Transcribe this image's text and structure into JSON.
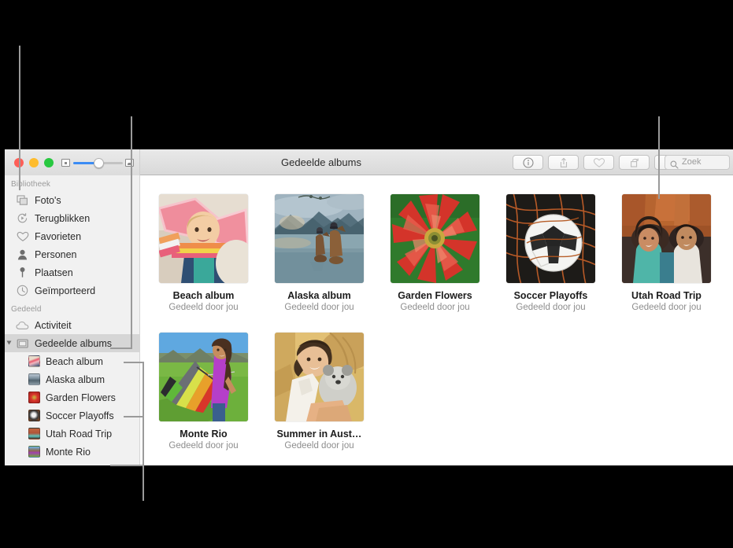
{
  "window": {
    "title": "Gedeelde albums",
    "traffic_lights": [
      "close",
      "minimize",
      "maximize"
    ],
    "zoom_slider": {
      "min_icon": "small-thumbnail-icon",
      "max_icon": "large-thumbnail-icon",
      "value_percent": 47
    }
  },
  "toolbar": {
    "buttons": [
      {
        "name": "info-button",
        "icon": "info-icon"
      },
      {
        "name": "share-button",
        "icon": "share-icon"
      },
      {
        "name": "favorite-button",
        "icon": "heart-icon"
      },
      {
        "name": "rotate-button",
        "icon": "rotate-icon"
      },
      {
        "name": "add-button",
        "icon": "plus-icon"
      }
    ],
    "search": {
      "placeholder": "Zoek",
      "value": "",
      "icon": "search-icon"
    }
  },
  "sidebar": {
    "sections": [
      {
        "header": "Bibliotheek",
        "items": [
          {
            "label": "Foto's",
            "icon": "photos-icon"
          },
          {
            "label": "Terugblikken",
            "icon": "memories-icon"
          },
          {
            "label": "Favorieten",
            "icon": "heart-icon"
          },
          {
            "label": "Personen",
            "icon": "person-icon"
          },
          {
            "label": "Plaatsen",
            "icon": "pin-icon"
          },
          {
            "label": "Geïmporteerd",
            "icon": "clock-icon"
          }
        ]
      },
      {
        "header": "Gedeeld",
        "items": [
          {
            "label": "Activiteit",
            "icon": "cloud-icon"
          },
          {
            "label": "Gedeelde albums",
            "icon": "shared-albums-icon",
            "selected": true,
            "expanded": true
          }
        ],
        "children": [
          {
            "label": "Beach album",
            "thumb": "beach"
          },
          {
            "label": "Alaska album",
            "thumb": "alaska"
          },
          {
            "label": "Garden Flowers",
            "thumb": "garden"
          },
          {
            "label": "Soccer Playoffs",
            "thumb": "soccer"
          },
          {
            "label": "Utah Road Trip",
            "thumb": "utah"
          },
          {
            "label": "Monte Rio",
            "thumb": "monte"
          }
        ]
      }
    ]
  },
  "main": {
    "albums": [
      {
        "title": "Beach album",
        "subtitle": "Gedeeld door jou",
        "thumb": "beach"
      },
      {
        "title": "Alaska album",
        "subtitle": "Gedeeld door jou",
        "thumb": "alaska"
      },
      {
        "title": "Garden Flowers",
        "subtitle": "Gedeeld door jou",
        "thumb": "garden"
      },
      {
        "title": "Soccer Playoffs",
        "subtitle": "Gedeeld door jou",
        "thumb": "soccer"
      },
      {
        "title": "Utah Road Trip",
        "subtitle": "Gedeeld door jou",
        "thumb": "utah"
      },
      {
        "title": "Monte Rio",
        "subtitle": "Gedeeld door jou",
        "thumb": "monte"
      },
      {
        "title": "Summer in Aust…",
        "subtitle": "Gedeeld door jou",
        "thumb": "summer"
      }
    ]
  },
  "callouts": {
    "line_color": "#9a9a9a",
    "items": [
      {
        "name": "callout-sidebar-library",
        "target": "Bibliotheek section"
      },
      {
        "name": "callout-shared-albums",
        "target": "Gedeelde albums row"
      },
      {
        "name": "callout-album-list",
        "target": "shared album list"
      },
      {
        "name": "callout-toolbar-right",
        "target": "toolbar / search area"
      }
    ]
  },
  "colors": {
    "background": "#000000",
    "window_chrome": "#e4e4e4",
    "sidebar": "#f1f1f1",
    "selection": "#d6d6d6",
    "accent": "#3b8cf4",
    "traffic_close": "#ff5f57",
    "traffic_min": "#febc2e",
    "traffic_max": "#28c840"
  }
}
